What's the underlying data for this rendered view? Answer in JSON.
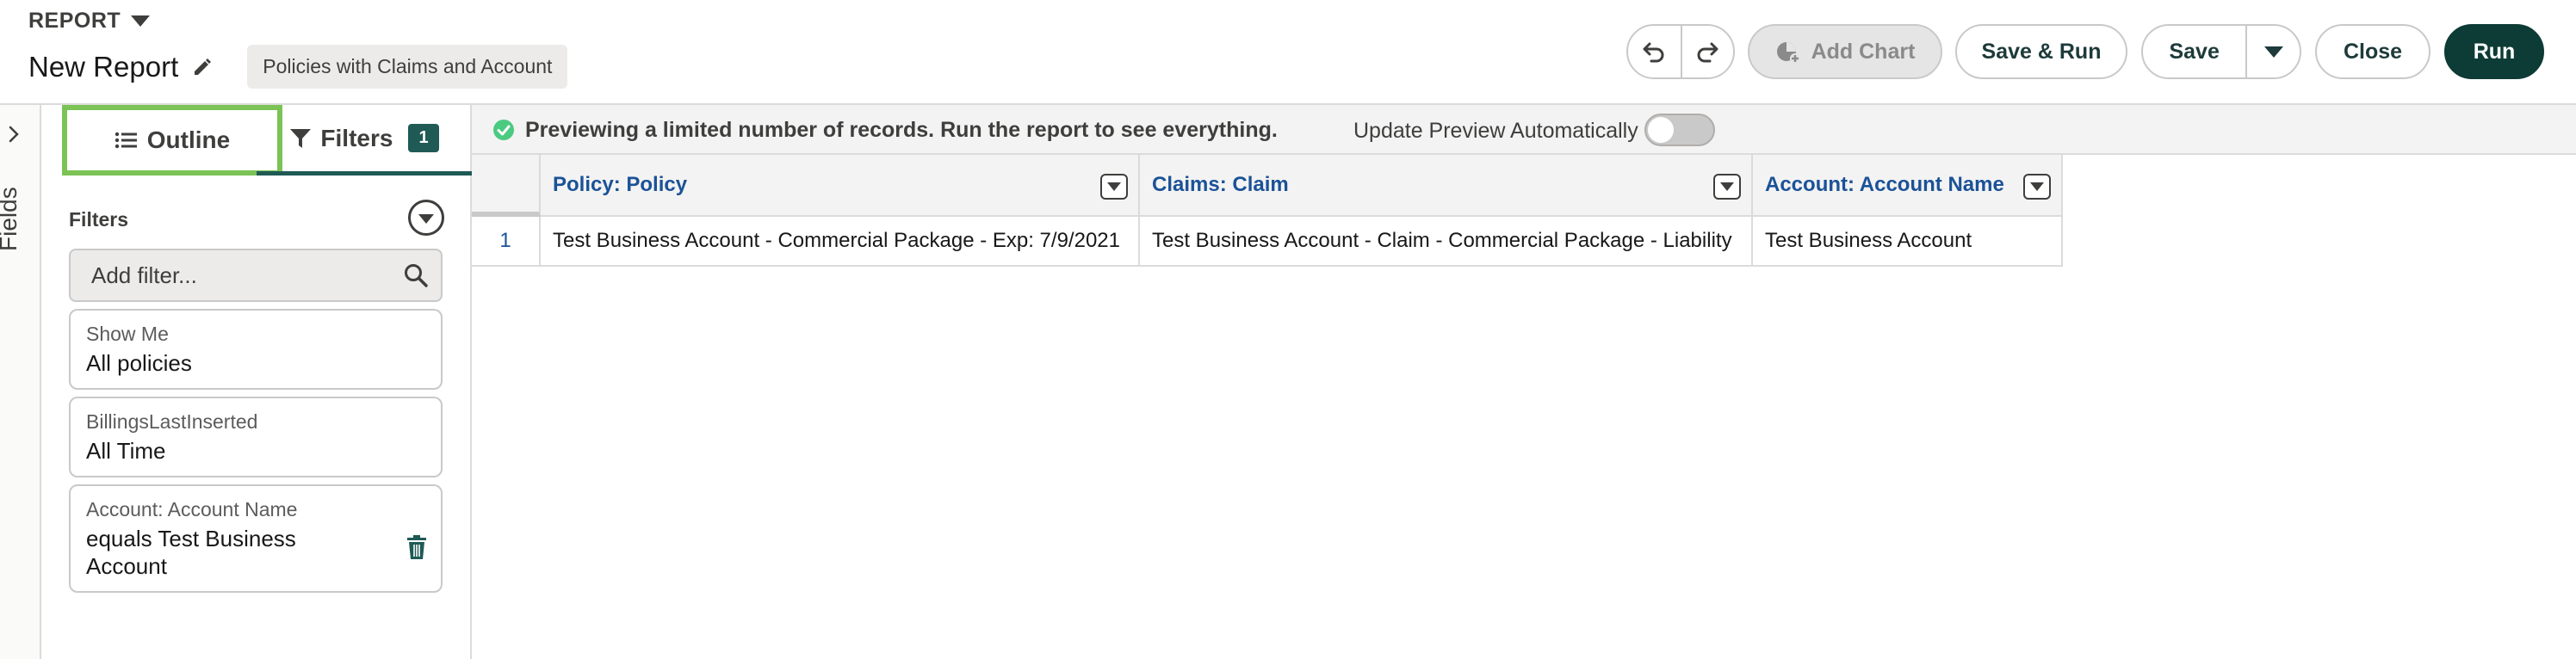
{
  "header": {
    "report_label": "REPORT",
    "title": "New Report",
    "report_type": "Policies with Claims and Account",
    "buttons": {
      "add_chart": "Add Chart",
      "save_run": "Save & Run",
      "save": "Save",
      "close": "Close",
      "run": "Run"
    }
  },
  "fields_rail": {
    "label": "Fields"
  },
  "left_panel": {
    "tabs": [
      {
        "label": "Outline",
        "icon": "list-icon",
        "selected": false
      },
      {
        "label": "Filters",
        "icon": "filter-icon",
        "badge": "1",
        "selected": true
      }
    ],
    "filters_heading": "Filters",
    "add_filter_placeholder": "Add filter...",
    "filters": [
      {
        "label": "Show Me",
        "value": "All policies"
      },
      {
        "label": "BillingsLastInserted",
        "value": "All Time"
      },
      {
        "label": "Account: Account Name",
        "value": "equals Test Business Account",
        "deletable": true
      }
    ]
  },
  "preview": {
    "message": "Previewing a limited number of records. Run the report to see everything.",
    "update_label": "Update Preview Automatically",
    "auto_update": false
  },
  "table": {
    "columns": [
      "Policy: Policy",
      "Claims: Claim",
      "Account: Account Name"
    ],
    "rows": [
      {
        "num": "1",
        "cells": [
          "Test Business Account - Commercial Package - Exp: 7/9/2021",
          "Test Business Account - Claim - Commercial Package - Liability",
          "Test Business Account"
        ]
      }
    ]
  },
  "colors": {
    "accent": "#0d3b36",
    "link": "#1b5297",
    "highlight": "#7cc355",
    "success": "#4bca81"
  }
}
